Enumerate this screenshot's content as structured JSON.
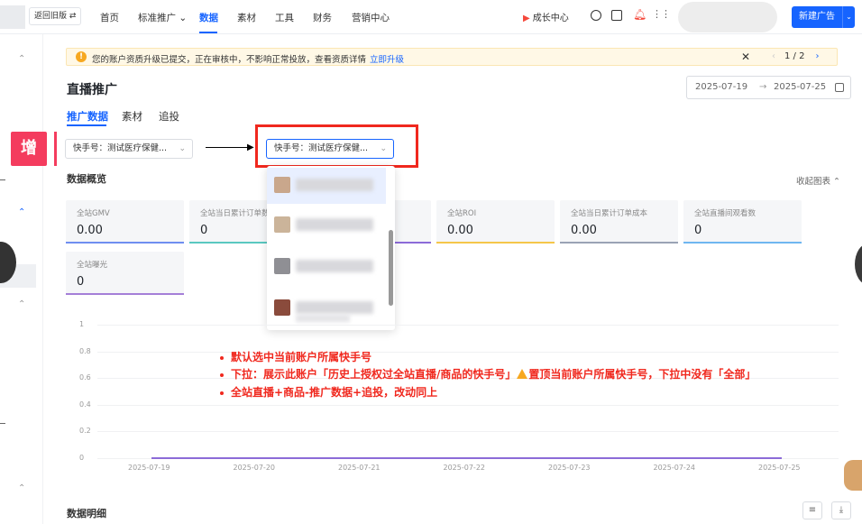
{
  "topbar": {
    "legacy_label": "返回旧版 ⇄",
    "nav": [
      {
        "label": "首页"
      },
      {
        "label": "标准推广 ⌄"
      },
      {
        "label": "数据"
      },
      {
        "label": "素材"
      },
      {
        "label": "工具"
      },
      {
        "label": "财务"
      },
      {
        "label": "营销中心"
      }
    ],
    "growth_center": "成长中心",
    "new_ad": "新建广告"
  },
  "notice": {
    "text": "您的账户资质升级已提交，正在审核中，不影响正常投放，查看资质详情",
    "link": "立即升级",
    "close": "✕",
    "pager_prev": "‹",
    "pager": "1 / 2",
    "pager_next": "›"
  },
  "page": {
    "title": "直播推广",
    "date_start": "2025-07-19",
    "date_arrow": "→",
    "date_end": "2025-07-25"
  },
  "tabs": [
    {
      "label": "推广数据"
    },
    {
      "label": "素材"
    },
    {
      "label": "追投"
    }
  ],
  "annotation": {
    "tag": "增",
    "notes": [
      "默认选中当前账户所属快手号",
      "下拉：展示此账户「历史上授权过全站直播/商品的快手号」",
      "置顶当前账户所属快手号，下拉中没有「全部」",
      "全站直播+商品-推广数据+追投，改动同上"
    ]
  },
  "selector": {
    "value": "快手号：测试医疗保健...",
    "chevron": "⌄"
  },
  "overview": {
    "title": "数据概览",
    "collapse": "收起图表 ⌃",
    "cards": [
      {
        "label": "全站GMV",
        "value": "0.00",
        "color": "#6f8ef0"
      },
      {
        "label": "全站当日累计订单数",
        "value": "0",
        "color": "#5ac8c0"
      },
      {
        "label": "全站ROI",
        "value": "0.00",
        "color": "#f5c64a"
      },
      {
        "label": "全站当日累计订单成本",
        "value": "0.00",
        "color": "#9aa3b5"
      },
      {
        "label": "全站直播间观看数",
        "value": "0",
        "color": "#6fb6f0"
      },
      {
        "label": "全站曝光",
        "value": "0",
        "color": "#a57fd8"
      }
    ]
  },
  "chart_data": {
    "type": "line",
    "x": [
      "2025-07-19",
      "2025-07-20",
      "2025-07-21",
      "2025-07-22",
      "2025-07-23",
      "2025-07-24",
      "2025-07-25"
    ],
    "yticks": [
      "1",
      "0.8",
      "0.6",
      "0.4",
      "0.2",
      "0"
    ],
    "ylim": [
      0,
      1
    ],
    "series": [
      {
        "values": [
          0,
          0,
          0,
          0,
          0,
          0,
          0
        ],
        "color": "#8c6bd8"
      }
    ],
    "grid": true
  },
  "detail": {
    "title": "数据明细",
    "filter_icon": "≡",
    "download_icon": "⤓"
  }
}
